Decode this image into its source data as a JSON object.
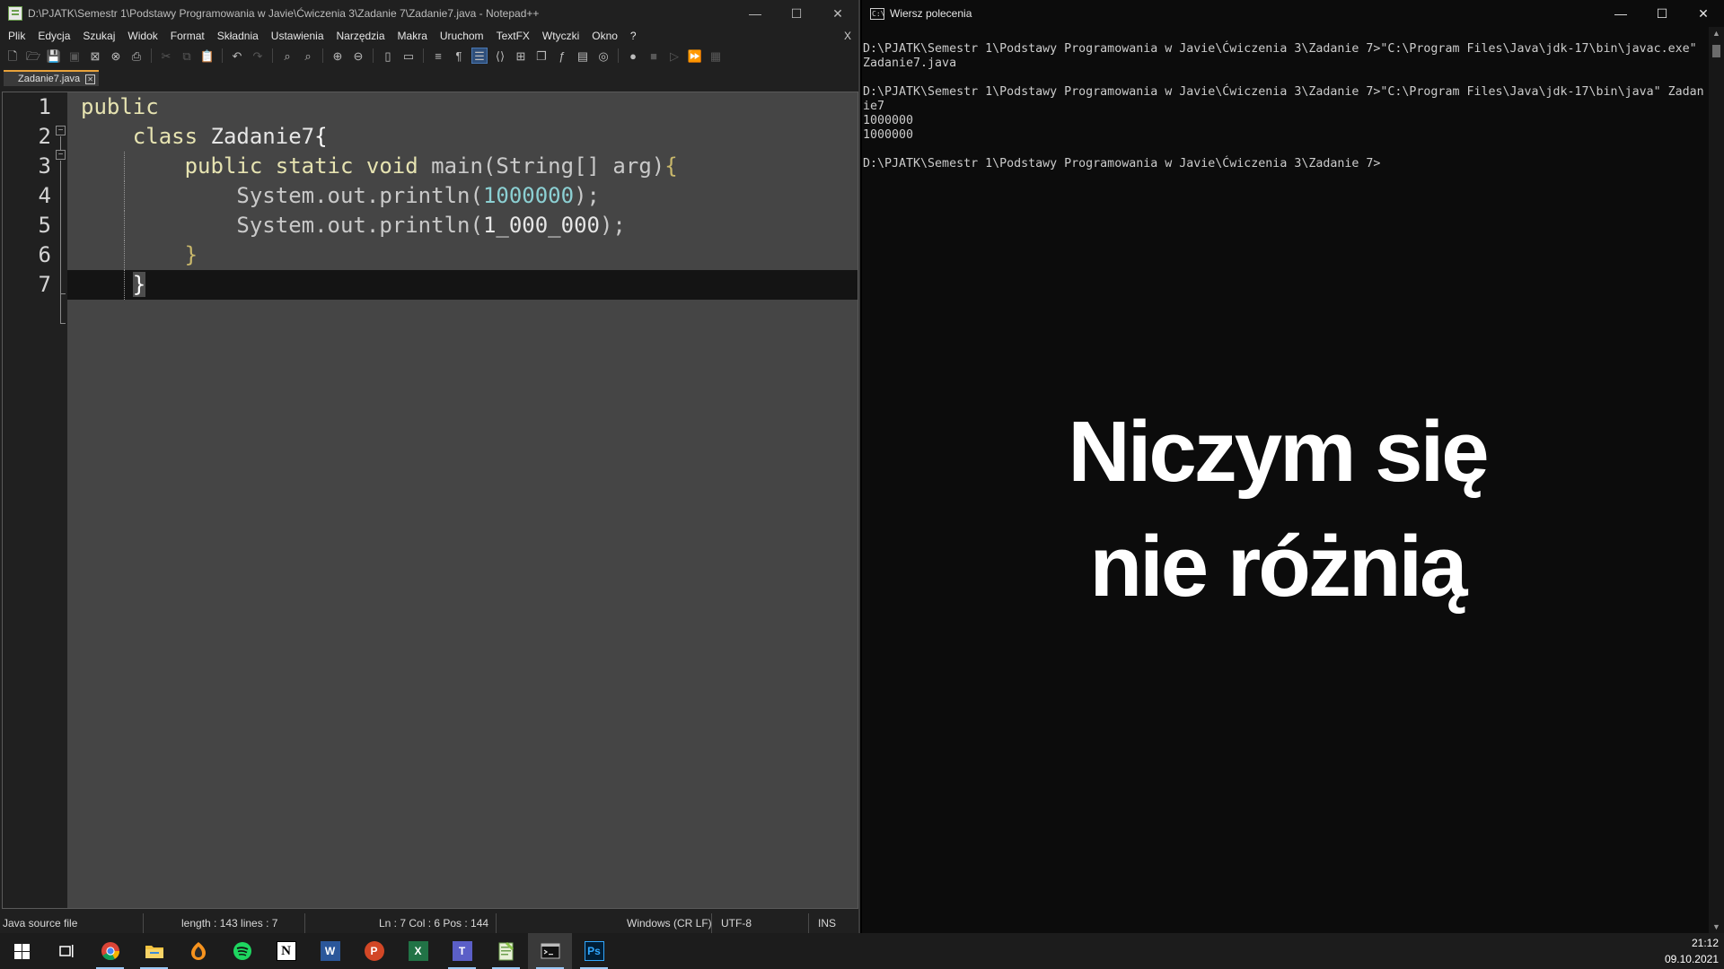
{
  "notepad": {
    "title": "D:\\PJATK\\Semestr 1\\Podstawy Programowania w Javie\\Ćwiczenia 3\\Zadanie 7\\Zadanie7.java - Notepad++",
    "menu": [
      "Plik",
      "Edycja",
      "Szukaj",
      "Widok",
      "Format",
      "Składnia",
      "Ustawienia",
      "Narzędzia",
      "Makra",
      "Uruchom",
      "TextFX",
      "Wtyczki",
      "Okno",
      "?"
    ],
    "menu_close": "X",
    "tab": "Zadanie7.java",
    "line_numbers": [
      "1",
      "2",
      "3",
      "4",
      "5",
      "6",
      "7"
    ],
    "code": {
      "l1_kw": "public",
      "l2_kw": "class",
      "l2_name": " Zadanie7",
      "l2_brace": "{",
      "l3_kw": "public static void",
      "l3_rest": " main(String[] arg)",
      "l3_brace": "{",
      "l4_call": "System.out.println(",
      "l4_num": "1000000",
      "l4_end": ");",
      "l5_call": "System.out.println(",
      "l5_num": "1_000_000",
      "l5_end": ");",
      "l6_brace": "}",
      "l7_brace": "}"
    },
    "status": {
      "filetype": "Java source file",
      "length": "length : 143    lines : 7",
      "position": "Ln : 7    Col : 6    Pos : 144",
      "eol": "Windows (CR LF)",
      "encoding": "UTF-8",
      "mode": "INS"
    }
  },
  "cmd": {
    "title": "Wiersz polecenia",
    "icon_text": "C:\\",
    "lines": [
      "D:\\PJATK\\Semestr 1\\Podstawy Programowania w Javie\\Ćwiczenia 3\\Zadanie 7>\"C:\\Program Files\\Java\\jdk-17\\bin\\javac.exe\"",
      "Zadanie7.java",
      "",
      "D:\\PJATK\\Semestr 1\\Podstawy Programowania w Javie\\Ćwiczenia 3\\Zadanie 7>\"C:\\Program Files\\Java\\jdk-17\\bin\\java\" Zadan",
      "ie7",
      "1000000",
      "1000000",
      "",
      "D:\\PJATK\\Semestr 1\\Podstawy Programowania w Javie\\Ćwiczenia 3\\Zadanie 7>"
    ],
    "overlay_line1": "Niczym się",
    "overlay_line2": "nie różnią"
  },
  "window_buttons": {
    "minimize": "—",
    "maximize": "☐",
    "close": "✕"
  },
  "taskbar": {
    "apps": [
      "start",
      "task-view",
      "chrome",
      "file-explorer",
      "fl-studio",
      "spotify",
      "notion",
      "word",
      "powerpoint",
      "excel",
      "teams",
      "notepad-plus-plus",
      "command-prompt",
      "photoshop"
    ],
    "time": "21:12",
    "date": "09.10.2021"
  },
  "colors": {
    "editor_bg": "#454545",
    "keyword": "#e6e3b1",
    "number": "#8cd0d3",
    "tab_accent": "#e8a23a",
    "console_bg": "#0c0c0c"
  }
}
